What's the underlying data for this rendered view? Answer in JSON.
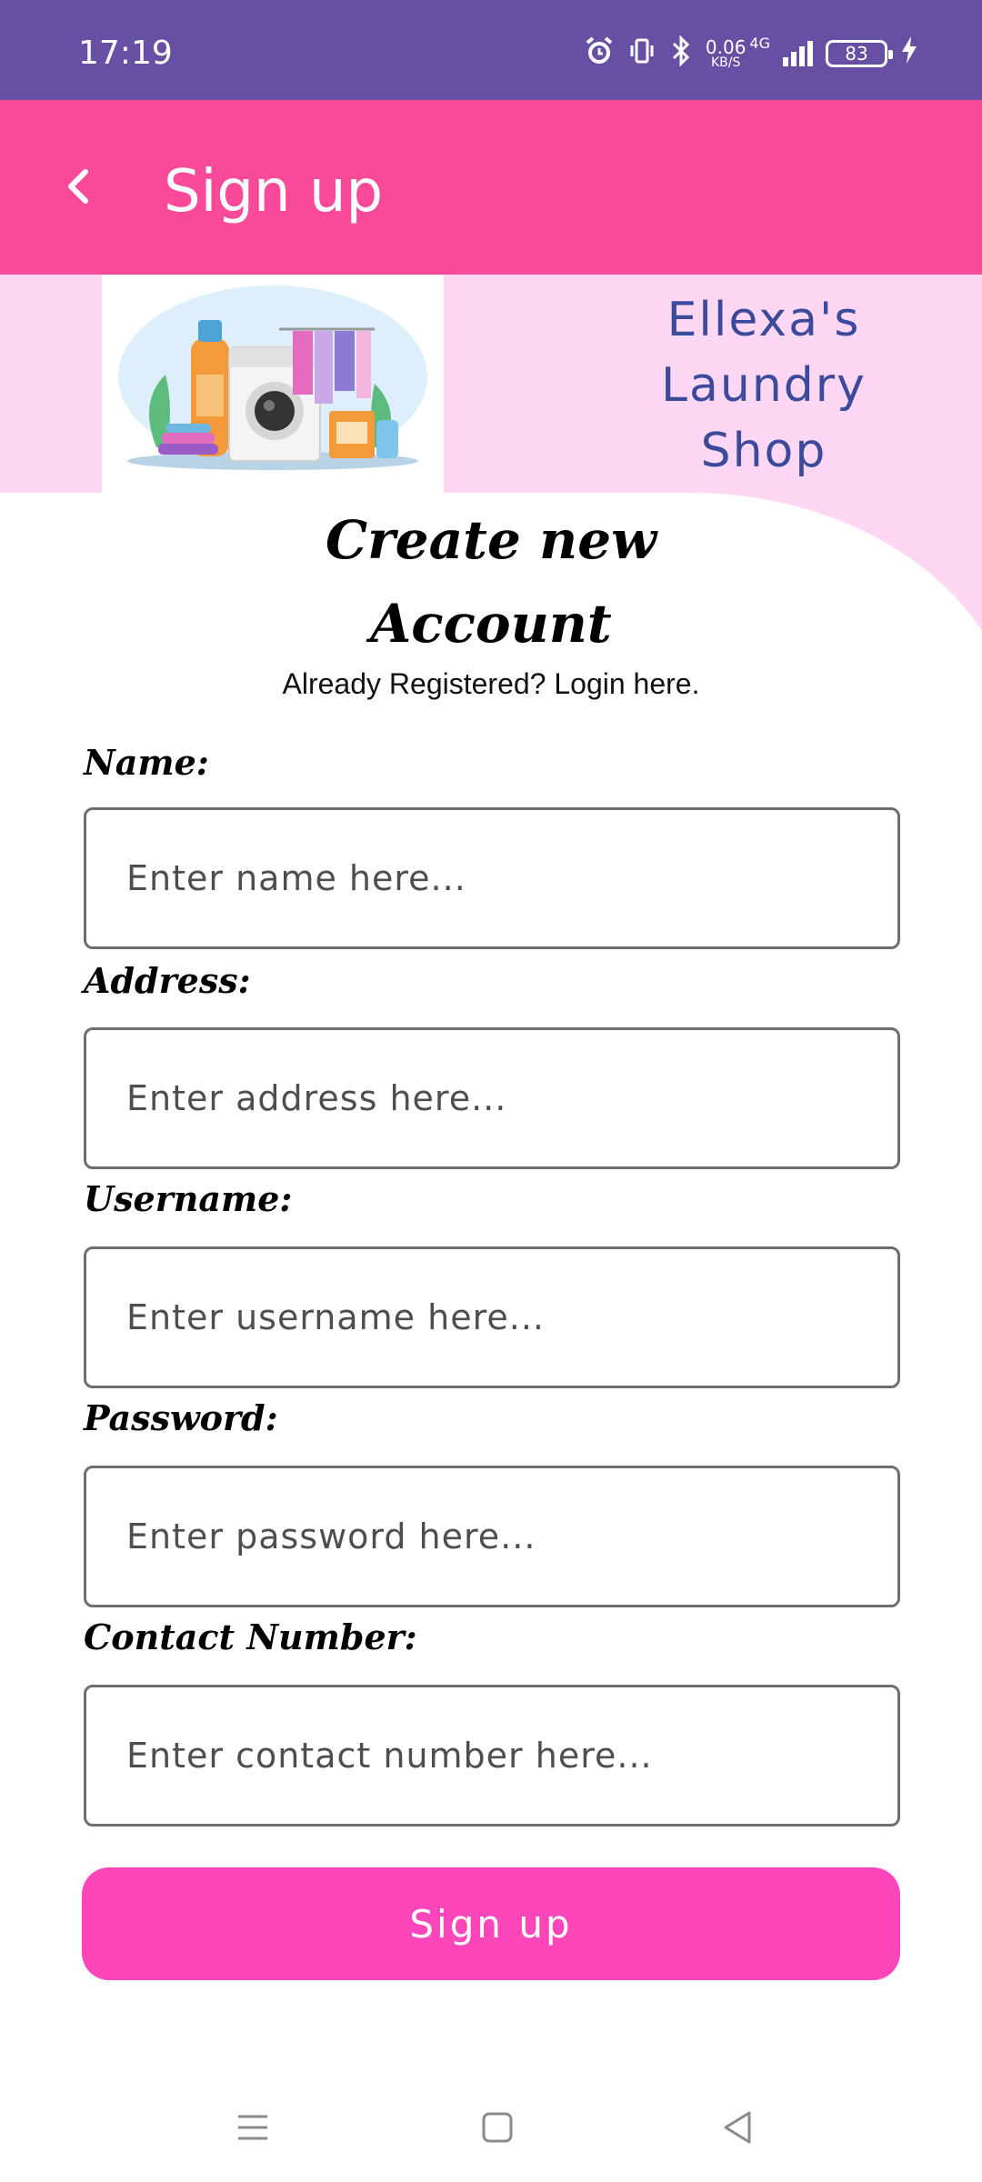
{
  "status_bar": {
    "time": "17:19",
    "network_speed": "0.06",
    "network_unit": "KB/S",
    "network_type": "4G",
    "battery": "83",
    "icons": [
      "alarm-icon",
      "vibrate-icon",
      "bluetooth-icon",
      "signal-icon",
      "battery-icon",
      "charging-icon"
    ]
  },
  "app_bar": {
    "title": "Sign up",
    "back_icon": "chevron-left-icon"
  },
  "banner": {
    "shop_name_line1": "Ellexa's",
    "shop_name_line2": "Laundry",
    "shop_name_line3": "Shop",
    "background_color": "#FDD7F3"
  },
  "heading": {
    "line1": "Create new",
    "line2": "Account",
    "login_text": "Already Registered? Login here."
  },
  "form": {
    "name_label": "Name:",
    "name_placeholder": "Enter name here...",
    "address_label": "Address:",
    "address_placeholder": "Enter address here...",
    "username_label": "Username:",
    "username_placeholder": "Enter username here...",
    "password_label": "Password:",
    "password_placeholder": "Enter password here...",
    "contact_label": "Contact Number:",
    "contact_placeholder": "Enter contact number here...",
    "submit_label": "Sign up"
  },
  "colors": {
    "status_bar": "#6750A4",
    "app_bar": "#F94A99",
    "button": "#FD46B9",
    "shop_name": "#3B4A9A"
  },
  "nav_bar": {
    "icons": [
      "menu-icon",
      "home-square-icon",
      "back-triangle-icon"
    ]
  }
}
